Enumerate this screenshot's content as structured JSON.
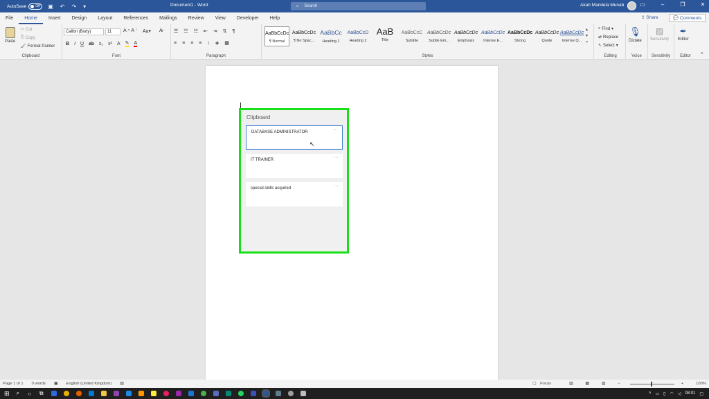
{
  "titlebar": {
    "autosave_label": "AutoSave",
    "autosave_state": "Off",
    "doc_title": "Document1 - Word",
    "search_placeholder": "Search",
    "user_name": "Akah Mandela Munab"
  },
  "tabs": [
    "File",
    "Home",
    "Insert",
    "Design",
    "Layout",
    "References",
    "Mailings",
    "Review",
    "View",
    "Developer",
    "Help"
  ],
  "active_tab": "Home",
  "share_label": "Share",
  "comments_label": "Comments",
  "ribbon": {
    "clipboard": {
      "paste": "Paste",
      "cut": "Cut",
      "copy": "Copy",
      "format_painter": "Format Painter",
      "label": "Clipboard"
    },
    "font": {
      "family": "Calibri (Body)",
      "size": "11",
      "label": "Font"
    },
    "paragraph": {
      "label": "Paragraph"
    },
    "styles": {
      "label": "Styles",
      "items": [
        {
          "sample": "AaBbCcDc",
          "name": "¶ Normal"
        },
        {
          "sample": "AaBbCcDc",
          "name": "¶ No Spac..."
        },
        {
          "sample": "AaBbCc",
          "name": "Heading 1"
        },
        {
          "sample": "AaBbCcD",
          "name": "Heading 2"
        },
        {
          "sample": "AaB",
          "name": "Title"
        },
        {
          "sample": "AaBbCcC",
          "name": "Subtitle"
        },
        {
          "sample": "AaBbCcDc",
          "name": "Subtle Em..."
        },
        {
          "sample": "AaBbCcDc",
          "name": "Emphasis"
        },
        {
          "sample": "AaBbCcDc",
          "name": "Intense E..."
        },
        {
          "sample": "AaBbCcDc",
          "name": "Strong"
        },
        {
          "sample": "AaBbCcDc",
          "name": "Quote"
        },
        {
          "sample": "AaBbCcDc",
          "name": "Intense Q..."
        }
      ]
    },
    "editing": {
      "find": "Find",
      "replace": "Replace",
      "select": "Select",
      "label": "Editing"
    },
    "voice": {
      "dictate": "Dictate",
      "label": "Voice"
    },
    "sensitivity": {
      "button": "Sensitivity",
      "label": "Sensitivity"
    },
    "editor": {
      "button": "Editor",
      "label": "Editor"
    }
  },
  "clipboard_pane": {
    "title": "Clipboard",
    "items": [
      "DATABASE ADMINISTRATOR",
      "IT TRAINER",
      "special skills acquired"
    ]
  },
  "statusbar": {
    "page": "Page 1 of 1",
    "words": "0 words",
    "language": "English (United Kingdom)",
    "focus": "Focus",
    "zoom": "100%"
  },
  "taskbar": {
    "time": "08:01"
  },
  "colors": {
    "word_blue": "#2b579a",
    "highlight_green": "#17e017",
    "selection_blue": "#3a7bd5"
  }
}
